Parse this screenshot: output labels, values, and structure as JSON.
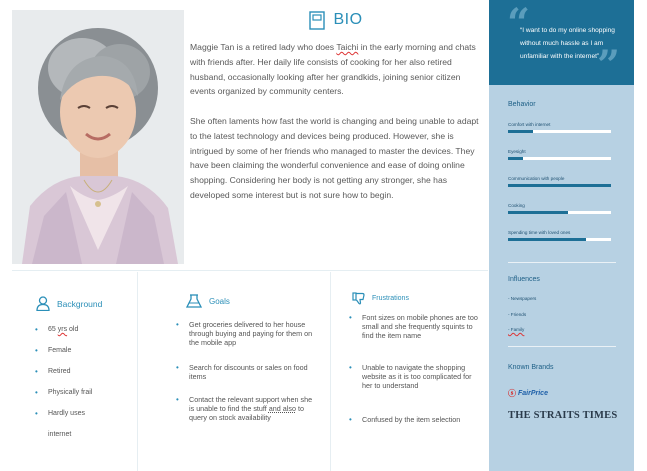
{
  "bio": {
    "title": "BIO",
    "p1_part1": "Maggie Tan is a retired lady who does ",
    "p1_taichi": "Taichi",
    "p1_part2": " in the early morning and chats with friends after. Her daily life consists of cooking for her also retired husband, occasionally looking after her grandkids, joining senior citizen events organized by community centers.",
    "p2": "She often laments how fast the world is changing and being unable to adapt to the latest technology and devices being produced. However, she is intrigued by some of her friends who managed to master the devices. They have been claiming the wonderful convenience and ease of doing online shopping. Considering her body is not getting any stronger, she has developed some interest but is not sure how to begin."
  },
  "quote": "“I want to do my online shopping without much hassle as I am unfamiliar with the internet”",
  "behavior": {
    "title": "Behavior",
    "items": [
      {
        "label": "Comfort with internet",
        "level": 0.24
      },
      {
        "label": "Eyesight",
        "level": 0.15
      },
      {
        "label": "Communication with people",
        "level": 1.0
      },
      {
        "label": "Cooking",
        "level": 0.58
      },
      {
        "label": "Spending time with loved ones",
        "level": 0.76
      }
    ]
  },
  "influences": {
    "title": "Influences",
    "items": [
      "- Newspapers",
      "- Friends",
      "- Family"
    ]
  },
  "brands": {
    "title": "Known Brands",
    "fairprice": "FairPrice",
    "straits": "THE STRAITS TIMES"
  },
  "background": {
    "title": "Background",
    "age_value": "65 ",
    "age_unit": "yrs",
    "age_tail": " old",
    "items": [
      "Female",
      "Retired",
      "Physically frail",
      "Hardly uses",
      "internet"
    ]
  },
  "goals": {
    "title": "Goals",
    "item1": "Get groceries delivered to her house through buying and paying for them on the mobile app",
    "item2": "Search for discounts or sales on food items",
    "item3_part1": "Contact the relevant support when she is unable to find the stuff ",
    "item3_and": "and also",
    "item3_part2": " to query on stock availability"
  },
  "frustrations": {
    "title": "Frustrations",
    "items": [
      "Font sizes on mobile phones are too small and she frequently squints to find the item name",
      "Unable to navigate the shopping website as it is too complicated for her to understand",
      "Confused by the item selection"
    ]
  },
  "colors": {
    "accent": "#2b8fb8",
    "sidebar": "#b7d1e3",
    "quote_bg": "#1d6f96",
    "bar_fill": "#1d6f96"
  }
}
